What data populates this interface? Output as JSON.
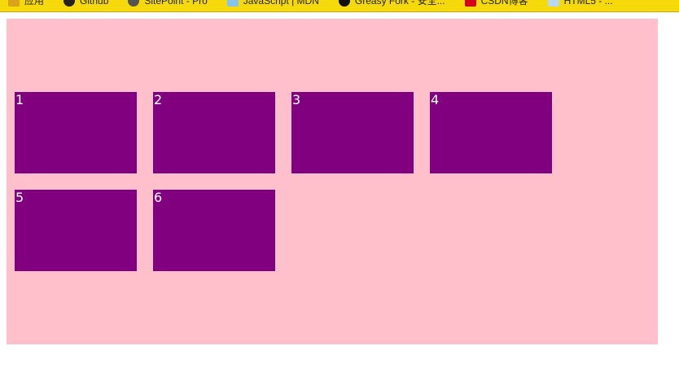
{
  "bookmarks": [
    {
      "label": "应用",
      "icon": "apps-folder-icon"
    },
    {
      "label": "Github",
      "icon": "github-icon"
    },
    {
      "label": "SitePoint - Pro",
      "icon": "settings-icon"
    },
    {
      "label": "JavaScript | MDN",
      "icon": "mdn-icon"
    },
    {
      "label": "Greasy Fork - 安全...",
      "icon": "yinyang-icon"
    },
    {
      "label": "CSDN博客",
      "icon": "csdn-icon"
    },
    {
      "label": "HTML5 - ...",
      "icon": "w3c-icon"
    }
  ],
  "container": {
    "background": "#ffc0cb",
    "box_color": "#800080"
  },
  "boxes": [
    "1",
    "2",
    "3",
    "4",
    "5",
    "6"
  ]
}
